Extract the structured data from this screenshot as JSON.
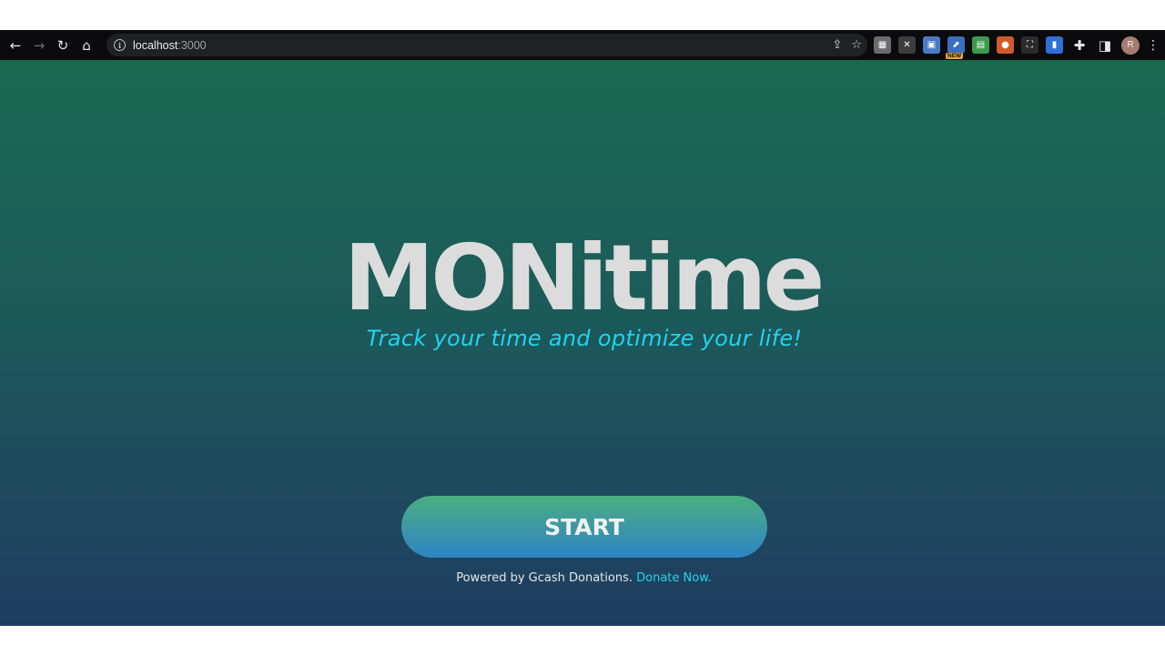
{
  "browser": {
    "url_host": "localhost",
    "url_port": ":3000",
    "back_icon": "←",
    "forward_icon": "→",
    "reload_icon": "↻",
    "home_icon": "⌂",
    "info_icon": "i",
    "share_icon": "⇪",
    "star_icon": "☆",
    "extensions": [
      {
        "name": "ext-1-icon",
        "color": "#6b6b6b",
        "glyph": "▦"
      },
      {
        "name": "ext-2-icon",
        "color": "#3d3d3d",
        "glyph": "✕"
      },
      {
        "name": "ext-3-icon",
        "color": "#4a79c7",
        "glyph": "▣"
      },
      {
        "name": "ext-4-icon",
        "color": "#3a6fc0",
        "glyph": "⬈",
        "badge": "NEW"
      },
      {
        "name": "ext-5-icon",
        "color": "#3c9a4a",
        "glyph": "▤"
      },
      {
        "name": "ext-6-icon",
        "color": "#d25a2a",
        "glyph": "●"
      },
      {
        "name": "ext-7-icon",
        "color": "#2b2b2b",
        "glyph": "⛶"
      },
      {
        "name": "ext-8-icon",
        "color": "#2f6fd6",
        "glyph": "▮"
      }
    ],
    "puzzle_icon": "✚",
    "sidepanel_icon": "◨",
    "avatar_letter": "R",
    "menu_icon": "⋮"
  },
  "app": {
    "title": "MONitime",
    "tagline": "Track your time and optimize your life!",
    "start_label": "START",
    "footer_text": "Powered by Gcash Donations.",
    "footer_link": "Donate Now."
  },
  "colors": {
    "accent": "#22d3ee",
    "title": "#dcdcdc",
    "bg_top": "#1a6a50",
    "bg_bottom": "#1f3d60"
  }
}
